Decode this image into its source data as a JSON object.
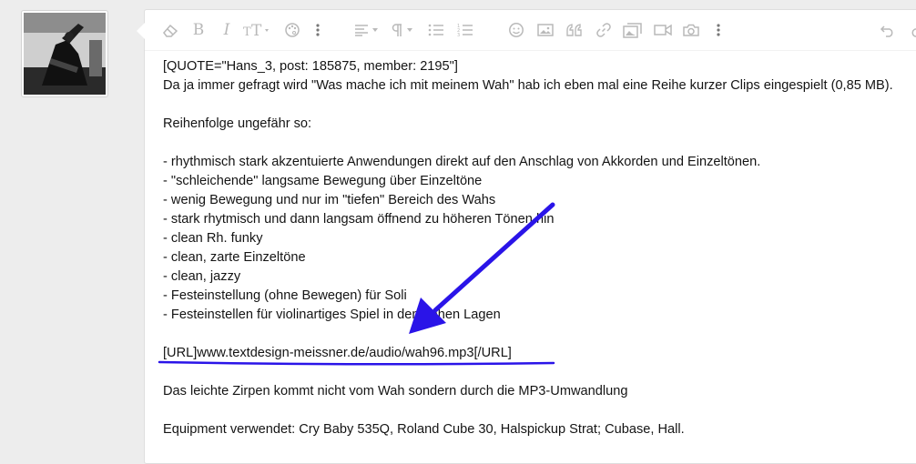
{
  "toolbar": {
    "buttons": [
      {
        "icon": "eraser-icon"
      },
      {
        "icon": "bold-icon",
        "glyph": "B"
      },
      {
        "icon": "italic-icon",
        "glyph": "I"
      },
      {
        "icon": "text-size-icon"
      },
      {
        "icon": "palette-icon"
      },
      {
        "icon": "more-vertical-icon"
      },
      {
        "icon": "align-icon"
      },
      {
        "icon": "paragraph-icon"
      },
      {
        "icon": "bullet-list-icon"
      },
      {
        "icon": "numbered-list-icon"
      },
      {
        "icon": "smiley-icon"
      },
      {
        "icon": "image-icon"
      },
      {
        "icon": "quote-icon"
      },
      {
        "icon": "link-icon"
      },
      {
        "icon": "gallery-icon"
      },
      {
        "icon": "video-icon"
      },
      {
        "icon": "camera-icon"
      },
      {
        "icon": "more-vertical-icon"
      },
      {
        "icon": "undo-icon"
      },
      {
        "icon": "redo-icon"
      }
    ]
  },
  "post": {
    "lines": [
      "[QUOTE=\"Hans_3, post: 185875, member: 2195\"]",
      "Da ja immer gefragt wird \"Was mache ich mit meinem Wah\" hab ich eben mal eine Reihe kurzer Clips eingespielt (0,85 MB).",
      "",
      "Reihenfolge ungefähr so:",
      "",
      "- rhythmisch stark akzentuierte Anwendungen direkt auf den Anschlag von Akkorden und Einzeltönen.",
      "- \"schleichende\" langsame Bewegung über Einzeltöne",
      "- wenig Bewegung und nur im \"tiefen\" Bereich des Wahs",
      "- stark rhytmisch und dann langsam öffnend zu höheren Tönen hin",
      "- clean Rh. funky",
      "- clean, zarte Einzeltöne",
      "- clean, jazzy",
      "- Festeinstellung (ohne Bewegen) für Soli",
      "- Festeinstellen für violinartiges Spiel in den hohen Lagen",
      "",
      "[URL]www.textdesign-meissner.de/audio/wah96.mp3[/URL]",
      "",
      "Das leichte Zirpen kommt nicht vom Wah sondern durch die MP3-Umwandlung",
      "",
      "Equipment verwendet: Cry Baby 535Q, Roland Cube 30, Halspickup Strat; Cubase, Hall."
    ]
  },
  "annotation": {
    "color": "#2a14e8",
    "highlighted_line": "[URL]www.textdesign-meissner.de/audio/wah96.mp3[/URL]"
  }
}
